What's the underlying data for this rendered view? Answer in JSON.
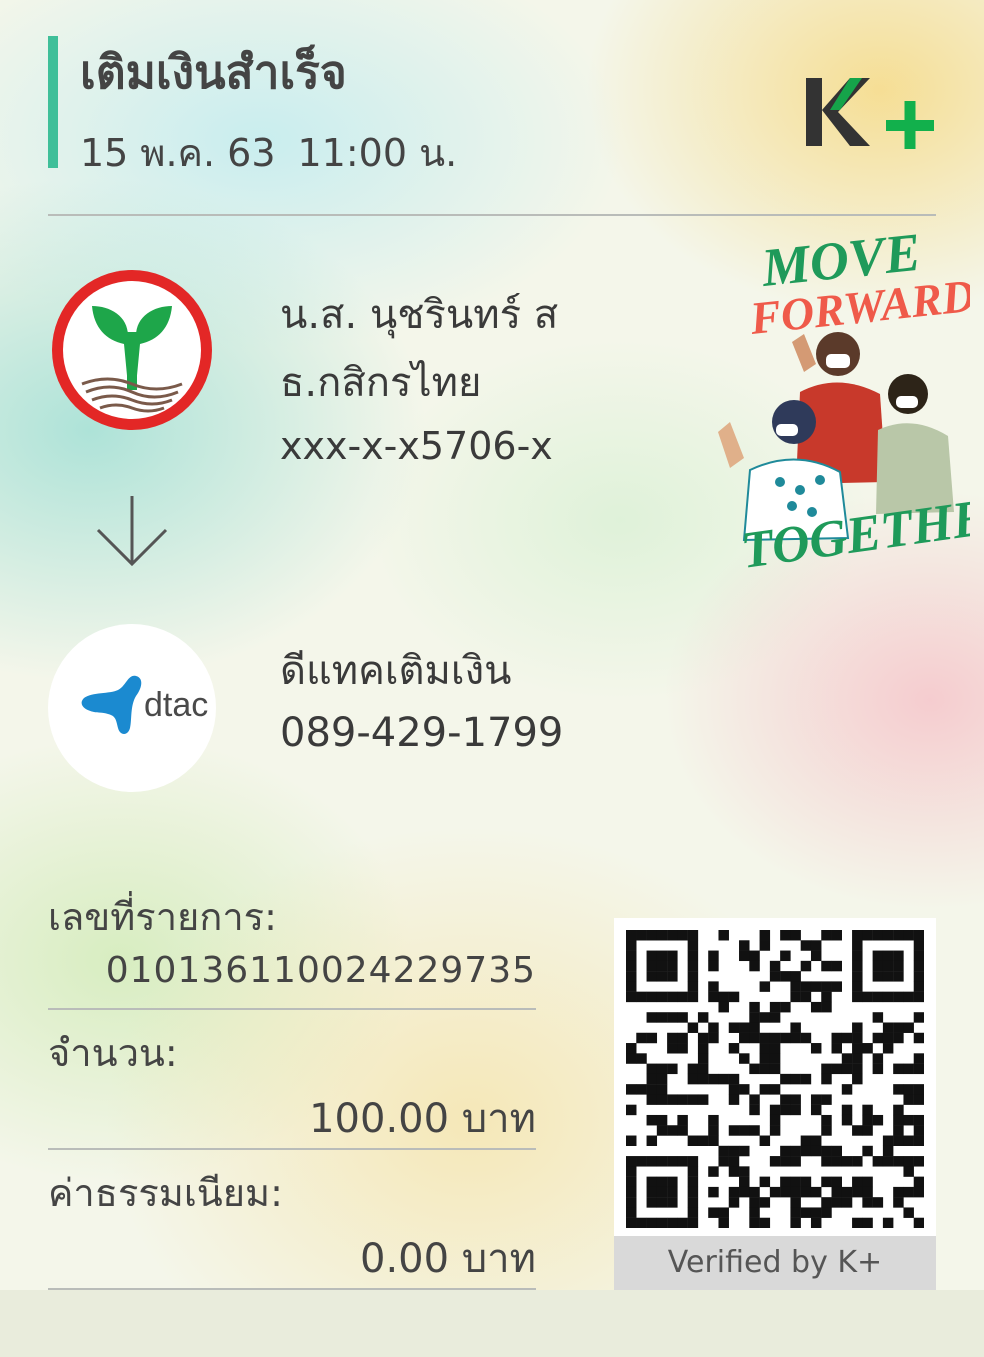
{
  "header": {
    "title": "เติมเงินสำเร็จ",
    "date": "15 พ.ค. 63",
    "time": "11:00 น."
  },
  "brand": {
    "logo_text": "K+"
  },
  "sender": {
    "name": "น.ส. นุชรินทร์ ส",
    "bank": "ธ.กสิกรไทย",
    "account": "xxx-x-x5706-x"
  },
  "receiver": {
    "name": "ดีแทคเติมเงิน",
    "number": "089-429-1799",
    "logo_text": "dtac"
  },
  "promo": {
    "line1": "MOVE",
    "line2": "FORWARD",
    "line3": "TOGETHER"
  },
  "details": {
    "ref_label": "เลขที่รายการ:",
    "ref_value": "010136110024229735",
    "amount_label": "จำนวน:",
    "amount_value": "100.00 บาท",
    "fee_label": "ค่าธรรมเนียม:",
    "fee_value": "0.00 บาท"
  },
  "qr": {
    "caption": "Verified by K+"
  },
  "colors": {
    "accent": "#3fbf99",
    "kbank_green": "#1ea64a",
    "kbank_red": "#e32726",
    "dtac_blue": "#1b8ad0",
    "kplus_dark": "#333333",
    "kplus_green": "#12b04c"
  }
}
